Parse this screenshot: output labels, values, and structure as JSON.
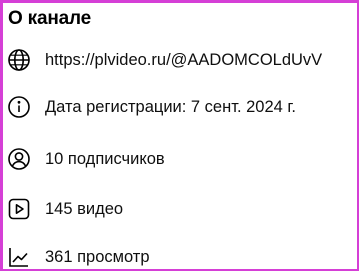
{
  "about": {
    "title": "О канале",
    "items": [
      {
        "icon": "globe-icon",
        "text": "https://plvideo.ru/@AADOMCOLdUvV"
      },
      {
        "icon": "info-icon",
        "text": "Дата регистрации: 7 сент. 2024 г."
      },
      {
        "icon": "user-circle-icon",
        "text": "10 подписчиков"
      },
      {
        "icon": "play-square-icon",
        "text": "145 видео"
      },
      {
        "icon": "trend-chart-icon",
        "text": "361 просмотр"
      }
    ]
  },
  "colors": {
    "border": "#d53fd6",
    "text": "#0f0f0f"
  }
}
